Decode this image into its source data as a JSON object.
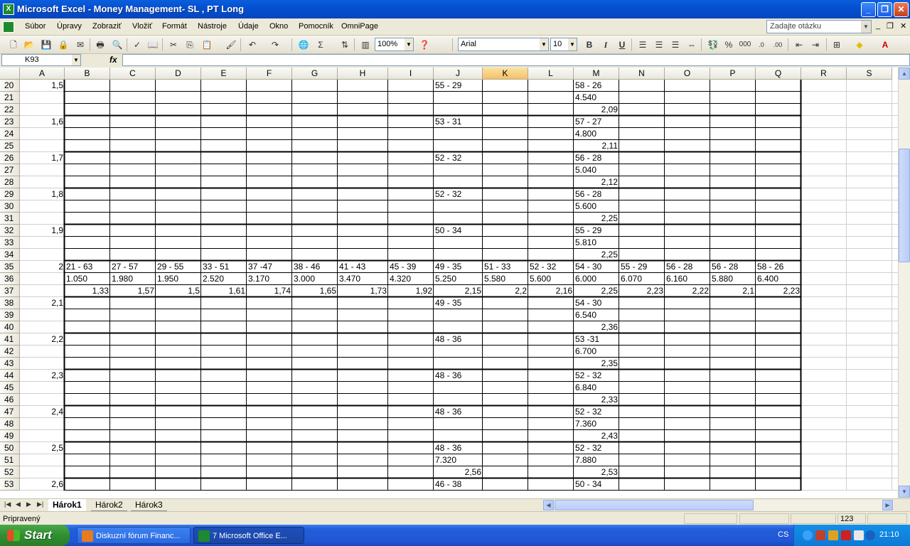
{
  "window": {
    "title": "Microsoft Excel - Money Management- SL , PT Long"
  },
  "menu": [
    "Súbor",
    "Úpravy",
    "Zobraziť",
    "Vložiť",
    "Formát",
    "Nástroje",
    "Údaje",
    "Okno",
    "Pomocník",
    "OmniPage"
  ],
  "ask_placeholder": "Zadajte otázku",
  "toolbar": {
    "zoom": "100%",
    "font": "Arial",
    "font_size": "10",
    "bold": "B",
    "italic": "I",
    "underline": "U",
    "percent": "%",
    "thousands": "000",
    "sigma": "Σ"
  },
  "formula": {
    "namebox": "K93",
    "fx": "fx",
    "content": ""
  },
  "columns": [
    "A",
    "B",
    "C",
    "D",
    "E",
    "F",
    "G",
    "H",
    "I",
    "J",
    "K",
    "L",
    "M",
    "N",
    "O",
    "P",
    "Q",
    "R",
    "S"
  ],
  "selected_column": "K",
  "rows": [
    {
      "n": "20",
      "cells": {
        "A": "1,5",
        "J": "55 - 29",
        "M": "58 - 26"
      }
    },
    {
      "n": "21",
      "cells": {
        "M": "4.540"
      }
    },
    {
      "n": "22",
      "cells": {
        "M": "2,09"
      }
    },
    {
      "n": "23",
      "cells": {
        "A": "1,6",
        "J": "53 - 31",
        "M": "57 - 27"
      }
    },
    {
      "n": "24",
      "cells": {
        "M": "4.800"
      }
    },
    {
      "n": "25",
      "cells": {
        "M": "2,11"
      }
    },
    {
      "n": "26",
      "cells": {
        "A": "1,7",
        "J": "52 - 32",
        "M": "56 - 28"
      }
    },
    {
      "n": "27",
      "cells": {
        "M": "5.040"
      }
    },
    {
      "n": "28",
      "cells": {
        "M": "2,12"
      }
    },
    {
      "n": "29",
      "cells": {
        "A": "1,8",
        "J": "52 - 32",
        "M": "56 - 28"
      }
    },
    {
      "n": "30",
      "cells": {
        "M": "5.600"
      }
    },
    {
      "n": "31",
      "cells": {
        "M": "2,25"
      }
    },
    {
      "n": "32",
      "cells": {
        "A": "1,9",
        "J": "50 - 34",
        "M": "55 - 29"
      }
    },
    {
      "n": "33",
      "cells": {
        "M": "5.810"
      }
    },
    {
      "n": "34",
      "cells": {
        "M": "2,25"
      }
    },
    {
      "n": "35",
      "cells": {
        "A": "2",
        "B": "21 - 63",
        "C": "27 - 57",
        "D": "29 - 55",
        "E": "33 - 51",
        "F": "37 -47",
        "G": "38 - 46",
        "H": "41 - 43",
        "I": "45 - 39",
        "J": "49 - 35",
        "K": "51 - 33",
        "L": "52 - 32",
        "M": "54 - 30",
        "N": "55 - 29",
        "O": "56 - 28",
        "P": "56 - 28",
        "Q": "58 - 26"
      }
    },
    {
      "n": "36",
      "cells": {
        "B": "1.050",
        "C": "1.980",
        "D": "1.950",
        "E": "2.520",
        "F": "3.170",
        "G": "3.000",
        "H": "3.470",
        "I": "4.320",
        "J": "5.250",
        "K": "5.580",
        "L": "5.600",
        "M": "6.000",
        "N": "6.070",
        "O": "6.160",
        "P": "5.880",
        "Q": "6.400"
      }
    },
    {
      "n": "37",
      "cells": {
        "B": "1,33",
        "C": "1,57",
        "D": "1,5",
        "E": "1,61",
        "F": "1,74",
        "G": "1,65",
        "H": "1,73",
        "I": "1,92",
        "J": "2,15",
        "K": "2,2",
        "L": "2,16",
        "M": "2,25",
        "N": "2,23",
        "O": "2,22",
        "P": "2,1",
        "Q": "2,23"
      }
    },
    {
      "n": "38",
      "cells": {
        "A": "2,1",
        "J": "49 - 35",
        "M": "54 - 30"
      }
    },
    {
      "n": "39",
      "cells": {
        "M": "6.540"
      }
    },
    {
      "n": "40",
      "cells": {
        "M": "2,36"
      }
    },
    {
      "n": "41",
      "cells": {
        "A": "2,2",
        "J": "48 - 36",
        "M": "53 -31"
      }
    },
    {
      "n": "42",
      "cells": {
        "M": "6.700"
      }
    },
    {
      "n": "43",
      "cells": {
        "M": "2,35"
      }
    },
    {
      "n": "44",
      "cells": {
        "A": "2,3",
        "J": "48 - 36",
        "M": "52 - 32"
      }
    },
    {
      "n": "45",
      "cells": {
        "M": "6.840"
      }
    },
    {
      "n": "46",
      "cells": {
        "M": "2,33"
      }
    },
    {
      "n": "47",
      "cells": {
        "A": "2,4",
        "J": "48 - 36",
        "M": "52 - 32"
      }
    },
    {
      "n": "48",
      "cells": {
        "M": "7.360"
      }
    },
    {
      "n": "49",
      "cells": {
        "M": "2,43"
      }
    },
    {
      "n": "50",
      "cells": {
        "A": "2,5",
        "J": "48 - 36",
        "M": "52 - 32"
      }
    },
    {
      "n": "51",
      "cells": {
        "J": "7.320",
        "M": "7.880"
      }
    },
    {
      "n": "52",
      "cells": {
        "J": "2,56",
        "M": "2,53"
      }
    },
    {
      "n": "53",
      "cells": {
        "A": "2,6",
        "J": "46 - 38",
        "M": "50 - 34"
      }
    }
  ],
  "sheets": [
    "Hárok1",
    "Hárok2",
    "Hárok3"
  ],
  "active_sheet": "Hárok1",
  "status": {
    "text": "Pripravený",
    "num": "123"
  },
  "taskbar": {
    "start": "Start",
    "items": [
      "Diskuzní fórum Financ...",
      "7 Microsoft Office E..."
    ],
    "lang": "CS",
    "clock": "21:10"
  }
}
